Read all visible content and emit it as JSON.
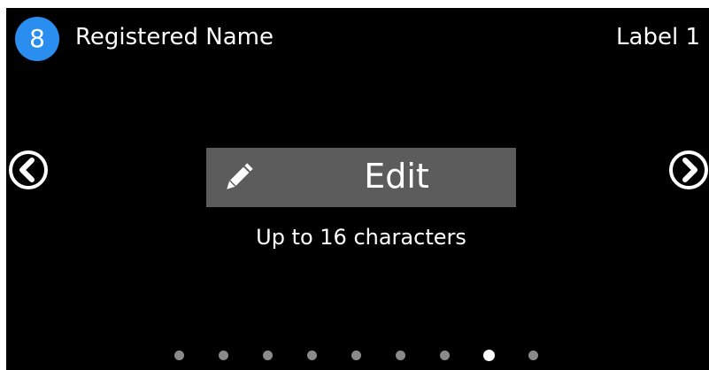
{
  "header": {
    "step_number": "8",
    "title": "Registered Name",
    "label_indicator": "Label 1"
  },
  "main": {
    "edit_button": {
      "label": "Edit",
      "icon": "pencil-icon"
    },
    "hint": "Up to 16 characters"
  },
  "navigation": {
    "prev_icon": "chevron-left-circle-icon",
    "next_icon": "chevron-right-circle-icon"
  },
  "pagination": {
    "total_pages": 9,
    "current_page": 8
  },
  "colors": {
    "background": "#000000",
    "badge": "#2a8ef0",
    "button": "#5c5c5c",
    "dot_inactive": "#8a8a8a",
    "dot_active": "#ffffff"
  }
}
